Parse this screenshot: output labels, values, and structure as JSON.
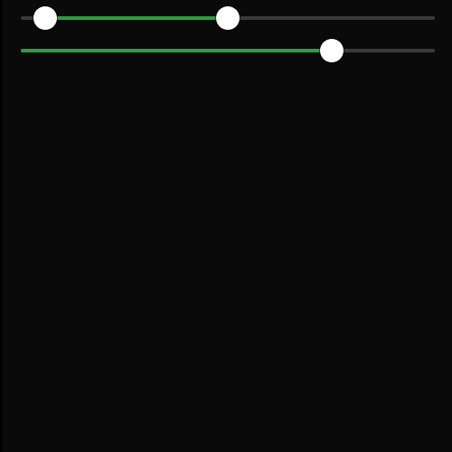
{
  "colors": {
    "background": "#0a0a0a",
    "track": "#3a3a3a",
    "fill": "#2e9e3e",
    "thumb": "#ffffff"
  },
  "sliders": [
    {
      "type": "range",
      "min": 0,
      "max": 100,
      "values": [
        6,
        50
      ]
    },
    {
      "type": "single",
      "min": 0,
      "max": 100,
      "value": 75
    }
  ]
}
